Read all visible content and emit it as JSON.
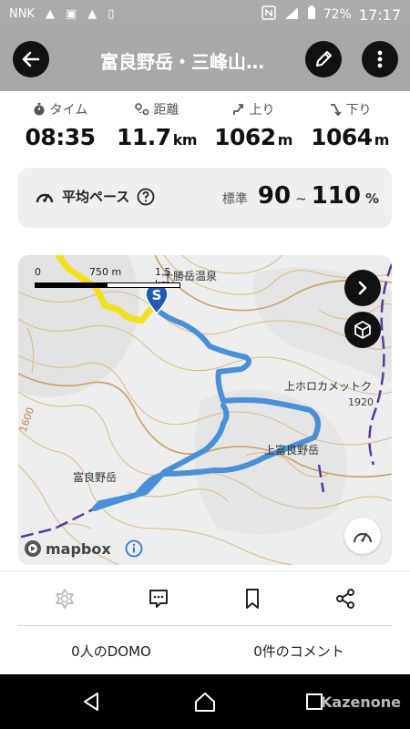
{
  "status_bar": {
    "left_icons": [
      "NNK",
      "▲",
      "▣",
      "▲",
      "▯"
    ],
    "battery": "72%",
    "time": "17:17"
  },
  "header": {
    "title": "富良野岳・三峰山…",
    "back_icon": "arrow-left-icon",
    "edit_icon": "pencil-icon",
    "more_icon": "more-vertical-icon"
  },
  "stats": {
    "time": {
      "label": "タイム",
      "value": "08:35",
      "unit": ""
    },
    "distance": {
      "label": "距離",
      "value": "11.7",
      "unit": "km"
    },
    "ascent": {
      "label": "上り",
      "value": "1062",
      "unit": "m"
    },
    "descent": {
      "label": "下り",
      "value": "1064",
      "unit": "m"
    }
  },
  "pace": {
    "label": "平均ペース",
    "standard_label": "標準",
    "min": "90",
    "tilde": "~",
    "max": "110",
    "unit": "%"
  },
  "map": {
    "scale": {
      "start": "0",
      "mid": "750 m",
      "end": "1.5 km"
    },
    "start_marker": "S",
    "labels": {
      "onsen": "十勝岳温泉",
      "kamihoro": "上ホロカメットク",
      "elev_1920": "1920",
      "kamifurano": "上富良野岳",
      "furano": "富良野岳",
      "contour_1600": "1600"
    },
    "attribution": "mapbox",
    "route_color": "#4a90d9",
    "highlight_color": "#f2e11a"
  },
  "actions": {
    "domo_count": "0人のDOMO",
    "comment_count": "0件のコメント"
  },
  "watermark": "Kazenone"
}
